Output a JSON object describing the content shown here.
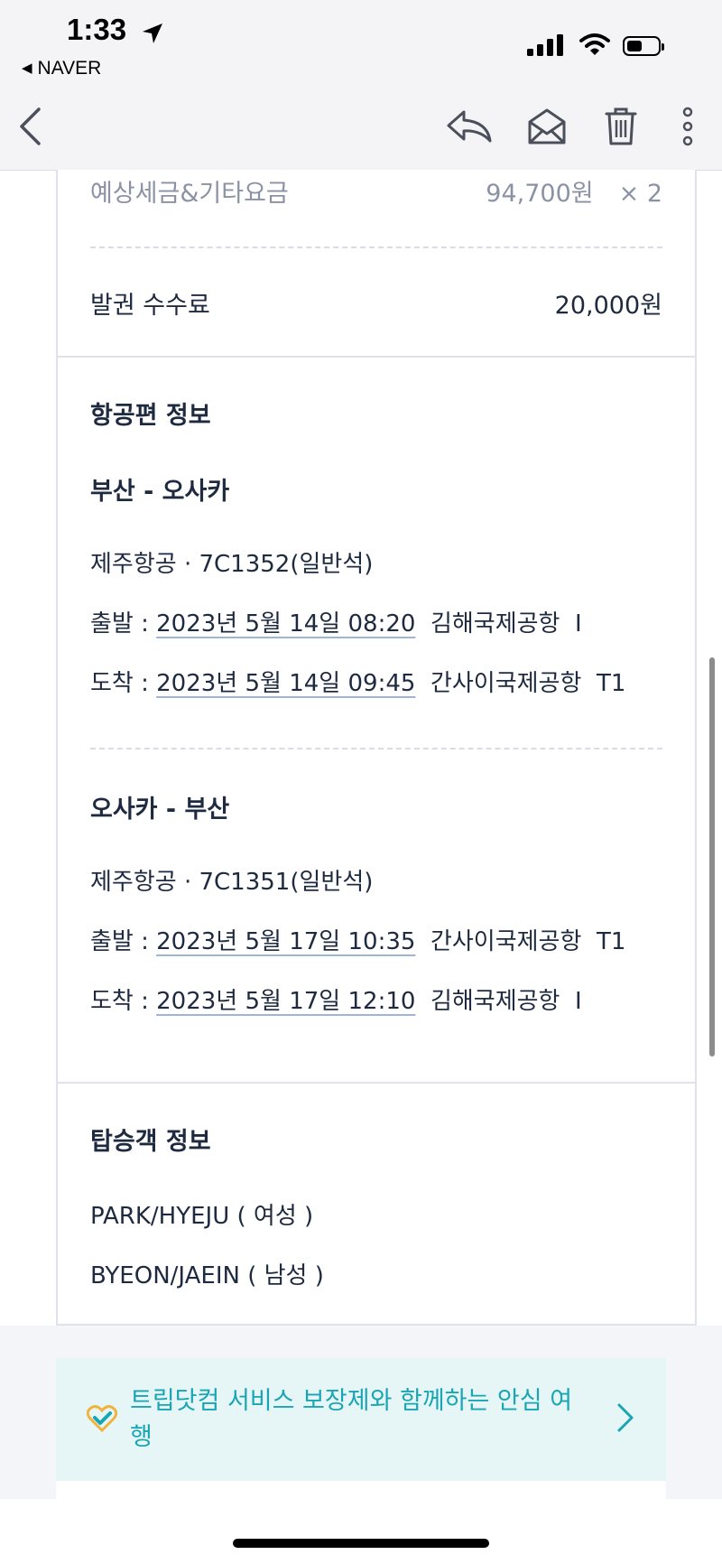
{
  "status_bar": {
    "time": "1:33",
    "back_app": "NAVER"
  },
  "toolbar": {
    "icons": [
      "back-chevron-icon",
      "reply-icon",
      "mark-unread-envelope-icon",
      "trash-icon",
      "more-vertical-icon"
    ]
  },
  "fare": {
    "tax_label": "예상세금&기타요금",
    "tax_value": "94,700원",
    "tax_qty": "× 2",
    "issue_fee_label": "발권 수수료",
    "issue_fee_value": "20,000원"
  },
  "flight_info": {
    "title": "항공편 정보",
    "legs": [
      {
        "route": "부산 - 오사카",
        "carrier": "제주항공 · 7C1352(일반석)",
        "depart_label": "출발 : ",
        "depart_time": "2023년 5월 14일 08:20",
        "depart_airport": "김해국제공항",
        "depart_terminal": "I",
        "arrive_label": "도착 : ",
        "arrive_time": "2023년 5월 14일 09:45",
        "arrive_airport": "간사이국제공항",
        "arrive_terminal": "T1"
      },
      {
        "route": "오사카 - 부산",
        "carrier": "제주항공 · 7C1351(일반석)",
        "depart_label": "출발 : ",
        "depart_time": "2023년 5월 17일 10:35",
        "depart_airport": "간사이국제공항",
        "depart_terminal": "T1",
        "arrive_label": "도착 : ",
        "arrive_time": "2023년 5월 17일 12:10",
        "arrive_airport": "김해국제공항",
        "arrive_terminal": "I"
      }
    ]
  },
  "passenger_info": {
    "title": "탑승객 정보",
    "passengers": [
      "PARK/HYEJU ( 여성 )",
      "BYEON/JAEIN ( 남성 )"
    ]
  },
  "banner": {
    "text": "트립닷컴 서비스 보장제와 함께하는 안심 여행"
  },
  "colors": {
    "text": "#1e2a3f",
    "muted": "#8a92a3",
    "accent": "#1aa5b4",
    "banner_bg": "#e6f6f6"
  }
}
